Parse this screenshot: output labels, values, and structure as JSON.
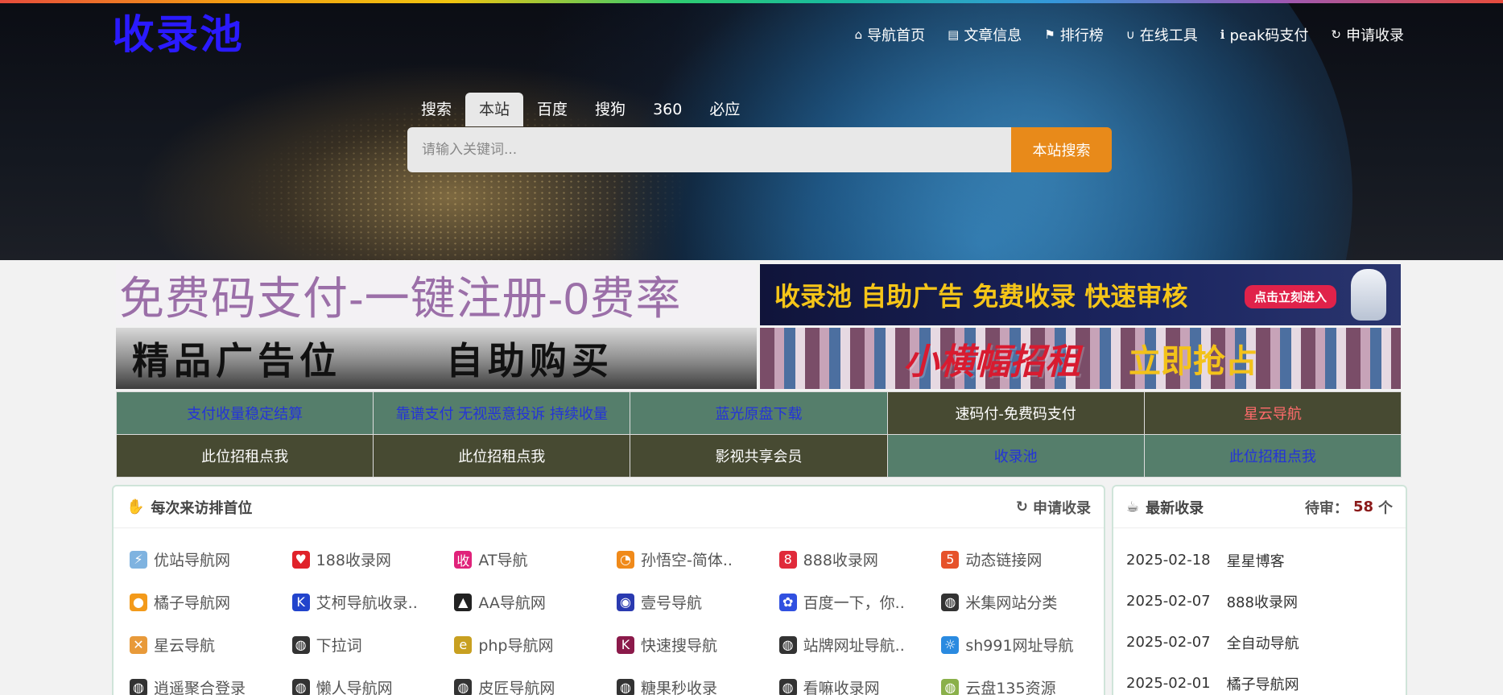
{
  "logo": "收录池",
  "nav": [
    {
      "icon": "⌂",
      "icon_name": "home-icon",
      "label": "导航首页"
    },
    {
      "icon": "▤",
      "icon_name": "book-icon",
      "label": "文章信息"
    },
    {
      "icon": "⚑",
      "icon_name": "flag-icon",
      "label": "排行榜"
    },
    {
      "icon": "∪",
      "icon_name": "magnet-icon",
      "label": "在线工具"
    },
    {
      "icon": "ℹ",
      "icon_name": "info-icon",
      "label": "peak码支付"
    },
    {
      "icon": "↻",
      "icon_name": "refresh-icon",
      "label": "申请收录"
    }
  ],
  "search": {
    "tabs": [
      "搜索",
      "本站",
      "百度",
      "搜狗",
      "360",
      "必应"
    ],
    "active_tab": "本站",
    "placeholder": "请输入关键词...",
    "button": "本站搜索"
  },
  "ads": {
    "ad1": "免费码支付-一键注册-0费率",
    "ad2": "收录池 自助广告 免费收录 快速审核",
    "ad2_cta": "点击立刻进入",
    "ad3_left": "精品广告位",
    "ad3_right": "自助购买",
    "ad4_left": "小横幅招租",
    "ad4_right": "立即抢占"
  },
  "text_links": [
    {
      "label": "支付收量稳定结算",
      "bg": "#557e6b",
      "color": "#2433d8"
    },
    {
      "label": "靠谱支付 无视恶意投诉 持续收量",
      "bg": "#557e6b",
      "color": "#2433d8"
    },
    {
      "label": "蓝光原盘下载",
      "bg": "#557e6b",
      "color": "#2433d8"
    },
    {
      "label": "速码付-免费码支付",
      "bg": "#474a32",
      "color": "#ffffff"
    },
    {
      "label": "星云导航",
      "bg": "#474a32",
      "color": "#ff6b6b"
    },
    {
      "label": "此位招租点我",
      "bg": "#474a32",
      "color": "#ffffff"
    },
    {
      "label": "此位招租点我",
      "bg": "#474a32",
      "color": "#ffffff"
    },
    {
      "label": "影视共享会员",
      "bg": "#474a32",
      "color": "#ffffff"
    },
    {
      "label": "收录池",
      "bg": "#557e6b",
      "color": "#2433d8"
    },
    {
      "label": "此位招租点我",
      "bg": "#557e6b",
      "color": "#2433d8"
    }
  ],
  "top_panel": {
    "title": "每次来访排首位",
    "action": "申请收录",
    "sites": [
      {
        "name": "优站导航网",
        "icon": "⚡",
        "bg": "#7fb3e0"
      },
      {
        "name": "188收录网",
        "icon": "♥",
        "bg": "#e0222a"
      },
      {
        "name": "AT导航",
        "icon": "收",
        "bg": "#e0227a"
      },
      {
        "name": "孙悟空-简体..",
        "icon": "◔",
        "bg": "#f08a1a"
      },
      {
        "name": "888收录网",
        "icon": "8",
        "bg": "#e02a3a"
      },
      {
        "name": "动态链接网",
        "icon": "5",
        "bg": "#e6522a"
      },
      {
        "name": "橘子导航网",
        "icon": "●",
        "bg": "#f39a1a"
      },
      {
        "name": "艾柯导航收录..",
        "icon": "K",
        "bg": "#2244cc"
      },
      {
        "name": "AA导航网",
        "icon": "▲",
        "bg": "#222222"
      },
      {
        "name": "壹号导航",
        "icon": "◉",
        "bg": "#2a3ab0"
      },
      {
        "name": "百度一下，你..",
        "icon": "✿",
        "bg": "#3050e0"
      },
      {
        "name": "米集网站分类",
        "icon": "◍",
        "bg": "#333333"
      },
      {
        "name": "星云导航",
        "icon": "✕",
        "bg": "#e89a3a"
      },
      {
        "name": "下拉词",
        "icon": "◍",
        "bg": "#333333"
      },
      {
        "name": "php导航网",
        "icon": "e",
        "bg": "#c8a020"
      },
      {
        "name": "快速搜导航",
        "icon": "K",
        "bg": "#8b1a4a"
      },
      {
        "name": "站牌网址导航..",
        "icon": "◍",
        "bg": "#333333"
      },
      {
        "name": "sh991网址导航",
        "icon": "☼",
        "bg": "#2a8ae0"
      },
      {
        "name": "逍遥聚合登录",
        "icon": "◍",
        "bg": "#333333"
      },
      {
        "name": "懒人导航网",
        "icon": "◍",
        "bg": "#333333"
      },
      {
        "name": "皮匠导航网",
        "icon": "◍",
        "bg": "#333333"
      },
      {
        "name": "糖果秒收录",
        "icon": "◍",
        "bg": "#333333"
      },
      {
        "name": "看嘛收录网",
        "icon": "◍",
        "bg": "#333333"
      },
      {
        "name": "云盘135资源",
        "icon": "◍",
        "bg": "#8ab04a"
      }
    ]
  },
  "recent_panel": {
    "title": "最新收录",
    "pending_label": "待审：",
    "pending_count": "58",
    "pending_unit": "个",
    "items": [
      {
        "date": "2025-02-18",
        "name": "星星博客"
      },
      {
        "date": "2025-02-07",
        "name": "888收录网"
      },
      {
        "date": "2025-02-07",
        "name": "全自动导航"
      },
      {
        "date": "2025-02-01",
        "name": "橘子导航网"
      }
    ]
  }
}
